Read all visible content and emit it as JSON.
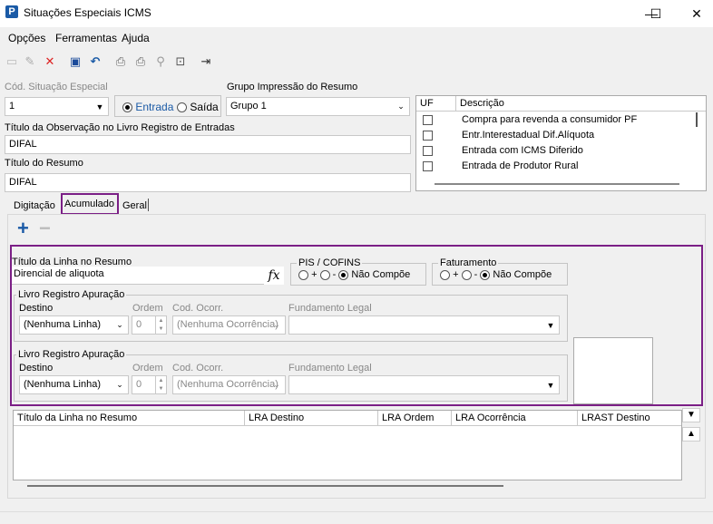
{
  "window": {
    "title": "Situações Especiais ICMS",
    "minimize": "—",
    "maximize": "☐",
    "close": "✕"
  },
  "menu": [
    "Opções",
    "Ferramentas",
    "Ajuda"
  ],
  "form": {
    "cod_label": "Cód. Situação Especial",
    "cod_value": "1",
    "radio_entrada": "Entrada",
    "radio_saida": "Saída",
    "grupo_label": "Grupo Impressão do Resumo",
    "grupo_value": "Grupo 1",
    "obs_label": "Título da Observação no Livro Registro de Entradas",
    "obs_value": "DIFAL",
    "resumo_label": "Título do Resumo",
    "resumo_value": "DIFAL"
  },
  "uf_grid": {
    "col_uf": "UF",
    "col_desc": "Descrição",
    "rows": [
      "Compra para revenda a consumidor PF",
      "Entr.Interestadual Dif.Alíquota",
      "Entrada com ICMS Diferido",
      "Entrada de Produtor Rural"
    ]
  },
  "tabs": [
    "Digitação",
    "Acumulado",
    "Geral"
  ],
  "acumulado": {
    "titulo_label": "Título da Linha no Resumo",
    "titulo_value": "Direncial de aliquota",
    "fx": "fx",
    "pis_label": "PIS / COFINS",
    "fat_label": "Faturamento",
    "opt_plus": "+",
    "opt_minus": "-",
    "opt_nao": "Não Compõe",
    "livro1": {
      "legend": "Livro Registro Apuração",
      "destino_label": "Destino",
      "destino_value": "(Nenhuma Linha)",
      "ordem_label": "Ordem",
      "ordem_value": "0",
      "cod_label": "Cod. Ocorr.",
      "cod_value": "(Nenhuma Ocorrência)",
      "fund_label": "Fundamento Legal"
    },
    "livro2": {
      "legend": "Livro Registro Apuração",
      "destino_label": "Destino",
      "destino_value": "(Nenhuma Linha)",
      "ordem_label": "Ordem",
      "ordem_value": "0",
      "cod_label": "Cod. Ocorr.",
      "cod_value": "(Nenhuma Ocorrência)",
      "fund_label": "Fundamento Legal"
    }
  },
  "bottom_grid": {
    "columns": [
      "Título da Linha no Resumo",
      "LRA Destino",
      "LRA Ordem",
      "LRA Ocorrência",
      "LRAST Destino"
    ]
  },
  "colors": {
    "accent_purple": "#7b1f86",
    "plus_blue": "#1a5aa6"
  }
}
